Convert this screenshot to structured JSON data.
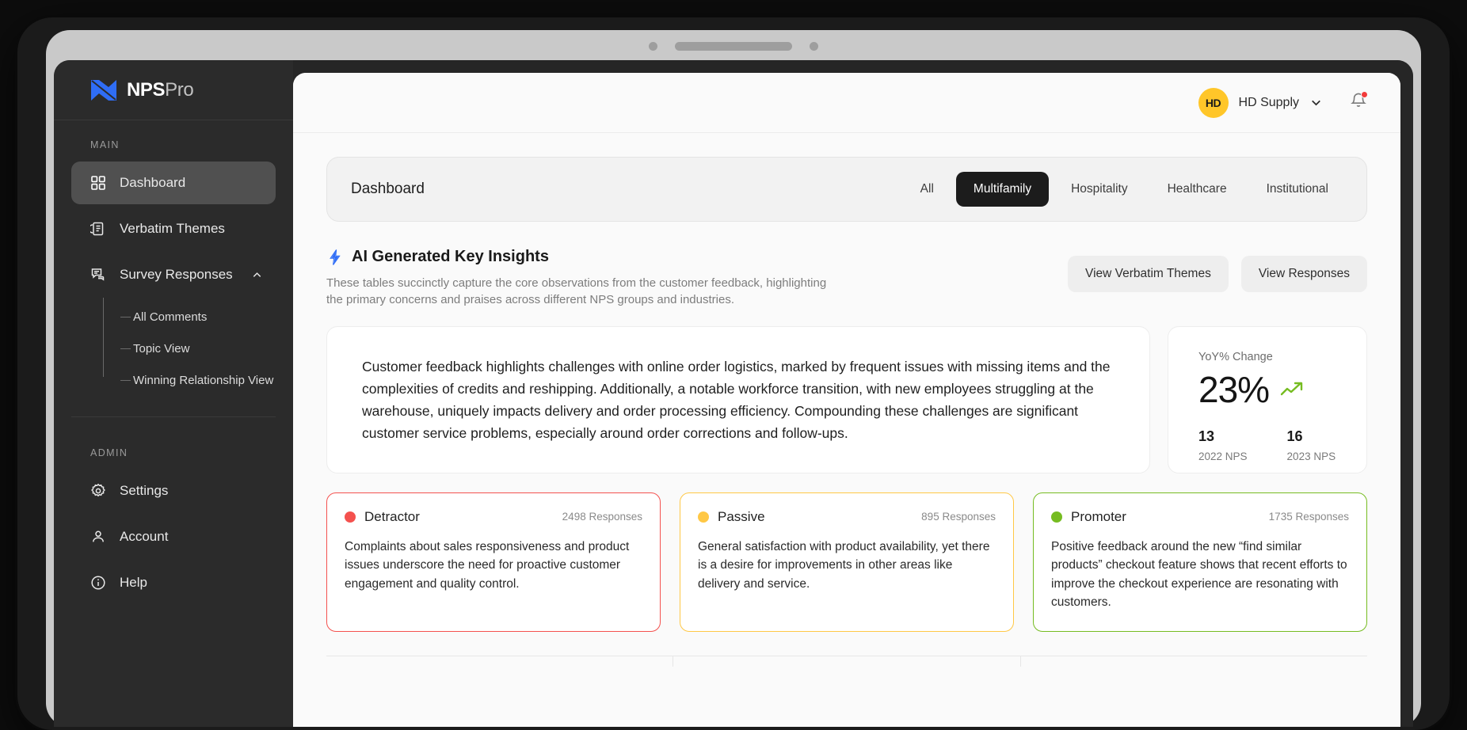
{
  "brand": {
    "name_bold": "NPS",
    "name_light": "Pro",
    "logo_color": "#2f6df6"
  },
  "sidebar": {
    "main_label": "MAIN",
    "admin_label": "ADMIN",
    "items": [
      {
        "label": "Dashboard",
        "icon": "grid-icon",
        "active": true
      },
      {
        "label": "Verbatim Themes",
        "icon": "document-icon",
        "active": false
      },
      {
        "label": "Survey Responses",
        "icon": "comments-icon",
        "active": false,
        "expanded": true
      }
    ],
    "sub_items": [
      {
        "label": "All Comments"
      },
      {
        "label": "Topic View"
      },
      {
        "label": "Winning Relationship View"
      }
    ],
    "admin_items": [
      {
        "label": "Settings",
        "icon": "gear-icon"
      },
      {
        "label": "Account",
        "icon": "user-icon"
      },
      {
        "label": "Help",
        "icon": "info-icon"
      }
    ]
  },
  "topbar": {
    "org_initials": "HD",
    "org_name": "HD Supply",
    "avatar_color": "#ffc629",
    "notification_color": "#f23b3b"
  },
  "tabcard": {
    "title": "Dashboard",
    "tabs": [
      {
        "label": "All",
        "active": false
      },
      {
        "label": "Multifamily",
        "active": true
      },
      {
        "label": "Hospitality",
        "active": false
      },
      {
        "label": "Healthcare",
        "active": false
      },
      {
        "label": "Institutional",
        "active": false
      }
    ]
  },
  "insights": {
    "title": "AI Generated Key Insights",
    "icon": "lightning-bolt-icon",
    "icon_color": "#2f6df6",
    "subtitle": "These tables succinctly capture the core observations from the customer feedback, highlighting the primary concerns and praises across different NPS groups and industries.",
    "buttons": [
      {
        "label": "View Verbatim Themes"
      },
      {
        "label": "View Responses"
      }
    ],
    "summary": "Customer feedback highlights challenges with online order logistics, marked by frequent issues with missing items and the complexities of credits and reshipping. Additionally, a notable workforce transition, with new employees struggling at the warehouse, uniquely impacts delivery and order processing efficiency. Compounding these challenges are significant customer service problems, especially around order corrections and follow-ups."
  },
  "stat": {
    "label": "YoY% Change",
    "value": "23%",
    "trend_icon": "trend-up-icon",
    "trend_color": "#76bc21",
    "prev_value": "13",
    "prev_label": "2022 NPS",
    "curr_value": "16",
    "curr_label": "2023 NPS"
  },
  "nps_cards": [
    {
      "name": "Detractor",
      "count": "2498 Responses",
      "color": "#f4514e",
      "border": "#f4514e",
      "text": "Complaints about sales responsiveness and product issues underscore the need for proactive customer engagement and quality control."
    },
    {
      "name": "Passive",
      "count": "895 Responses",
      "color": "#ffc846",
      "border": "#ffc846",
      "text": "General satisfaction with product availability, yet there is a desire for improvements in other areas like delivery and service."
    },
    {
      "name": "Promoter",
      "count": "1735 Responses",
      "color": "#76bc21",
      "border": "#76bc21",
      "text": "Positive feedback around the new “find similar products” checkout feature shows that recent efforts to improve the checkout experience are resonating with customers."
    }
  ]
}
